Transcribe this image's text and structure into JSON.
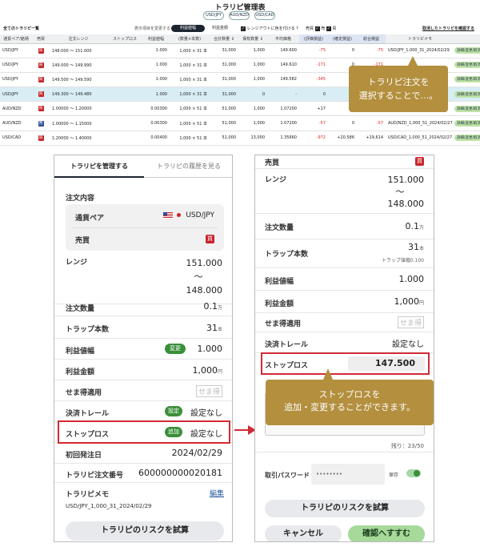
{
  "top": {
    "title": "トラリピ管理表",
    "pairs": [
      "USD/JPY",
      "AUD/NZD",
      "USD/CAD"
    ],
    "list_label": "全てのトラリピ一覧",
    "display_change_label": "表示項目を変更する",
    "toggle_profit": "利益値幅",
    "toggle_amount": "利益金額",
    "layout_check_label": "レンジアウトに色を付ける ?",
    "side_label": "売買",
    "sell_label": "売",
    "buy_label": "買",
    "cancelled_link": "取消したトラリピを確認する",
    "headers": [
      "通貨ペア/銘柄",
      "売買",
      "注文レンジ",
      "ストップロス",
      "利益値幅",
      "(数量×本数)",
      "合計数量 ↕",
      "保有数量 ↕",
      "平均価格",
      "(評価損益)",
      "(確定損益)",
      "総合損益",
      "トラリピメモ",
      ""
    ],
    "rows": [
      {
        "pair": "USD/JPY",
        "side": "買",
        "side_type": "sell",
        "range": "148.000 〜 151.000",
        "stoploss": "",
        "profit_width": "1.000",
        "qty": "1,000 × 31 本",
        "total": "31,000",
        "holding": "1,000",
        "avg": "149.600",
        "eval": "-75",
        "fixed": "0",
        "pl": "-75",
        "memo": "USD/JPY_1,000_31_2024/02/29",
        "action": "詳細/変更/取消"
      },
      {
        "pair": "USD/JPY",
        "side": "買",
        "side_type": "sell",
        "range": "149.000 〜 149.990",
        "stoploss": "",
        "profit_width": "1.000",
        "qty": "1,000 × 31 本",
        "total": "31,000",
        "holding": "1,000",
        "avg": "149.610",
        "eval": "-171",
        "fixed": "0",
        "pl": "-171",
        "memo": "",
        "action": "詳細/変更/取消"
      },
      {
        "pair": "USD/JPY",
        "side": "買",
        "side_type": "sell",
        "range": "149.500 〜 149.590",
        "stoploss": "",
        "profit_width": "1.000",
        "qty": "1,000 × 31 本",
        "total": "31,000",
        "holding": "1,000",
        "avg": "149.582",
        "eval": "-345",
        "fixed": "0",
        "pl": "",
        "memo": "",
        "action": "詳細/変更/取消"
      },
      {
        "pair": "USD/JPY",
        "side": "買",
        "side_type": "sell",
        "range": "149.300 〜 149.480",
        "stoploss": "",
        "profit_width": "1.000",
        "qty": "1,000 × 31 本",
        "total": "31,000",
        "holding": "0",
        "avg": "-",
        "eval": "0",
        "fixed": "0",
        "pl": "",
        "memo": "",
        "action": "詳細/変更/取消"
      },
      {
        "pair": "AUD/NZD",
        "side": "買",
        "side_type": "sell",
        "range": "1.00000 〜 1.20000",
        "stoploss": "",
        "profit_width": "0.00300",
        "qty": "1,000 × 51 本",
        "total": "51,000",
        "holding": "1,000",
        "avg": "1.07200",
        "eval": "+17",
        "fixed": "0",
        "pl": "",
        "memo": "",
        "action": "詳細/変更/取消"
      },
      {
        "pair": "AUD/NZD",
        "side": "売",
        "side_type": "buy",
        "range": "1.00000 〜 1.15000",
        "stoploss": "",
        "profit_width": "0.00300",
        "qty": "1,000 × 51 本",
        "total": "51,000",
        "holding": "1,000",
        "avg": "1.07200",
        "eval": "-57",
        "fixed": "0",
        "pl": "-57",
        "memo": "AUD/NZD_1,000_51_2024/02/27",
        "action": "詳細/変更/取消"
      },
      {
        "pair": "USD/CAD",
        "side": "買",
        "side_type": "sell",
        "range": "1.20000 〜 1.40000",
        "stoploss": "",
        "profit_width": "0.00400",
        "qty": "1,000 × 51 本",
        "total": "51,000",
        "holding": "13,000",
        "avg": "1.35660",
        "eval": "-972",
        "fixed": "+20,586",
        "pl": "+19,614",
        "memo": "USD/CAD_1,000_51_2024/02/27",
        "action": "詳細/変更/取消"
      }
    ],
    "callout": "トラリピ注文を\n選択することで…。"
  },
  "left": {
    "tab_manage": "トラリピを管理する",
    "tab_history": "トラリピの履歴を見る",
    "section": "注文内容",
    "pair_label": "通貨ペア",
    "pair_value": "USD/JPY",
    "side_label": "売買",
    "side_value": "買",
    "range_label": "レンジ",
    "range_high": "151.000",
    "range_sep": "〜",
    "range_low": "148.000",
    "qty_label": "注文数量",
    "qty_value": "0.1",
    "qty_unit": "万",
    "traps_label": "トラップ本数",
    "traps_value": "31",
    "traps_unit": "本",
    "width_label": "利益値幅",
    "width_btn": "変更",
    "width_value": "1.000",
    "amount_label": "利益金額",
    "amount_value": "1,000",
    "amount_unit": "円",
    "semate_label": "せま得適用",
    "semate_value": "せま得",
    "trail_label": "決済トレール",
    "trail_btn": "設定",
    "trail_value": "設定なし",
    "stop_label": "ストップロス",
    "stop_btn": "追加",
    "stop_value": "設定なし",
    "first_label": "初回発注日",
    "first_value": "2024/02/29",
    "orderno_label": "トラリピ注文番号",
    "orderno_value": "600000000020181",
    "memo_label": "トラリピメモ",
    "memo_edit": "編集",
    "memo_value": "USD/JPY_1,000_31_2024/02/29",
    "risk_btn": "トラリピのリスクを試算"
  },
  "right": {
    "side_label": "売買",
    "side_value": "買",
    "range_label": "レンジ",
    "range_high": "151.000",
    "range_sep": "〜",
    "range_low": "148.000",
    "qty_label": "注文数量",
    "qty_value": "0.1",
    "qty_unit": "万",
    "traps_label": "トラップ本数",
    "traps_value": "31",
    "traps_unit": "本",
    "traps_sub": "トラップ値幅0.100",
    "width_label": "利益値幅",
    "width_value": "1.000",
    "amount_label": "利益金額",
    "amount_value": "1,000",
    "amount_unit": "円",
    "semate_label": "せま得適用",
    "semate_value": "せま得",
    "trail_label": "決済トレール",
    "trail_value": "設定なし",
    "stop_label": "ストップロス",
    "stop_value": "147.500",
    "memo_label_partial": "ト",
    "memo_prefix": "US",
    "remaining": "残り：23/50",
    "password_label": "取引パスワード",
    "password_value": "••••••••",
    "save_label": "保存",
    "risk_btn": "トラリピのリスクを試算",
    "cancel_btn": "キャンセル",
    "confirm_btn": "確認へすすむ",
    "callout": "ストップロスを\n追加・変更することができます。"
  },
  "colors": {
    "accent_green": "#3a8f3a",
    "callout": "#b38f3e",
    "alert_red": "#d12a35",
    "sell": "#c8252b",
    "buy": "#2d4fa0"
  }
}
